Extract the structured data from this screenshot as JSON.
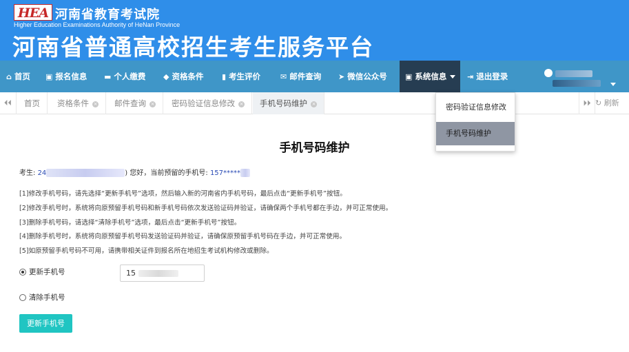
{
  "header": {
    "logo_text": "HEA",
    "org_name_cn": "河南省教育考试院",
    "org_name_en": "Higher Education Examinations Authority of HeNan Province",
    "platform_title": "河南省普通高校招生考生服务平台"
  },
  "nav": {
    "items": [
      {
        "label": "首页",
        "icon": "home-icon"
      },
      {
        "label": "报名信息",
        "icon": "id-card-icon"
      },
      {
        "label": "个人缴费",
        "icon": "credit-card-icon"
      },
      {
        "label": "资格条件",
        "icon": "tag-icon"
      },
      {
        "label": "考生评价",
        "icon": "book-icon"
      },
      {
        "label": "邮件查询",
        "icon": "envelope-icon"
      },
      {
        "label": "微信公众号",
        "icon": "send-icon"
      },
      {
        "label": "系统信息",
        "icon": "id-card-icon"
      },
      {
        "label": "退出登录",
        "icon": "sign-out-icon"
      }
    ]
  },
  "tabs": {
    "items": [
      "首页",
      "资格条件",
      "邮件查询",
      "密码验证信息修改",
      "手机号码维护"
    ],
    "refresh_label": "刷新"
  },
  "dropdown": {
    "items": [
      "密码验证信息修改",
      "手机号码维护"
    ]
  },
  "main": {
    "title": "手机号码维护",
    "student_prefix": "考生:",
    "student_id_visible": "24",
    "greeting": ") 您好，当前预留的手机号:",
    "phone_visible": "157*****",
    "notes": [
      "[1]修改手机号码，请先选择“更新手机号”选项，然后输入新的河南省内手机号码，最后点击“更新手机号”按钮。",
      "[2]修改手机号时，系统将向原预留手机号码和新手机号码依次发送验证码并验证，请确保两个手机号都在手边，并可正常使用。",
      "[3]删除手机号码，请选择“清除手机号”选项，最后点击“更新手机号”按钮。",
      "[4]删除手机号时，系统将向原预留手机号码发送验证码并验证，请确保原预留手机号码在手边，并可正常使用。",
      "[5]如原预留手机号码不可用，请携带相关证件到报名所在地招生考试机构修改或删除。"
    ],
    "option_update": "更新手机号",
    "option_clear": "清除手机号",
    "phone_input_value": "15",
    "submit_label": "更新手机号"
  },
  "colors": {
    "header_bg": "#2f8ee9",
    "nav_bg": "#3f96c8",
    "nav_active_bg": "#263d52",
    "button_bg": "#20c5c2",
    "highlight_text": "#2a4bb5"
  }
}
